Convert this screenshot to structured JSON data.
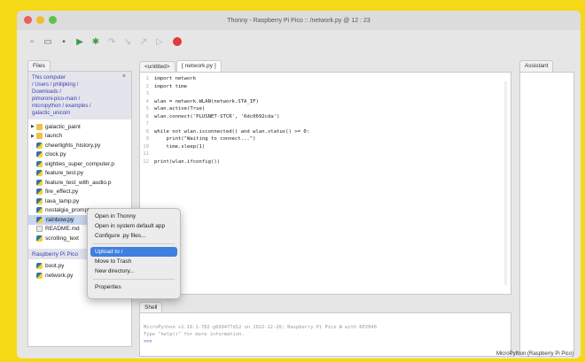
{
  "window": {
    "title": "Thonny - Raspberry Pi Pico :: /network.py @ 12 : 23"
  },
  "panes": {
    "files_tab": "Files",
    "editor_tabs": [
      "<untitled>",
      "[ network.py ]"
    ],
    "shell_tab": "Shell",
    "assistant_tab": "Assistant"
  },
  "files": {
    "path_lines": [
      "This computer",
      "/ Users / philipking /",
      "Downloads /",
      "pimoroni-pico-main /",
      "micropython / examples /",
      "galactic_unicorn"
    ],
    "items": [
      {
        "name": "galactic_paint",
        "kind": "folder",
        "expandable": "▶"
      },
      {
        "name": "launch",
        "kind": "folder",
        "expandable": "▶"
      },
      {
        "name": "cheerlights_history.py",
        "kind": "py"
      },
      {
        "name": "clock.py",
        "kind": "py"
      },
      {
        "name": "eighties_super_computer.p",
        "kind": "py"
      },
      {
        "name": "feature_test.py",
        "kind": "py"
      },
      {
        "name": "feature_test_with_audio.p",
        "kind": "py"
      },
      {
        "name": "fire_effect.py",
        "kind": "py"
      },
      {
        "name": "lava_lamp.py",
        "kind": "py"
      },
      {
        "name": "nostalgia_prompt.py",
        "kind": "py"
      },
      {
        "name": "rainbow.py",
        "kind": "py",
        "selected": true
      },
      {
        "name": "README.md",
        "kind": "doc"
      },
      {
        "name": "scrolling_text",
        "kind": "py"
      }
    ],
    "pico_header": "Raspberry Pi Pico",
    "pico_items": [
      {
        "name": "boot.py",
        "kind": "py"
      },
      {
        "name": "network.py",
        "kind": "py"
      }
    ]
  },
  "editor": {
    "lines": [
      "import network",
      "import time",
      "",
      "wlan = network.WLAN(network.STA_IF)",
      "wlan.active(True)",
      "wlan.connect('PLUSNET-STCR', '6dc0692cda')",
      "",
      "while not wlan.isconnected() and wlan.status() >= 0:",
      "    print(\"Waiting to connect...\")",
      "    time.sleep(1)",
      "",
      "print(wlan.ifconfig())"
    ]
  },
  "shell": {
    "banner": "MicroPython v1.19.1-782-g699477d12 on 2022-12-20; Raspberry Pi Pico W with RP2040",
    "hint": "Type \"help()\" for more information.",
    "prompt": ">>>"
  },
  "context_menu": {
    "items": [
      "Open in Thonny",
      "Open in system default app",
      "Configure .py files...",
      "Upload to /",
      "Move to Trash",
      "New directory...",
      "Properties"
    ],
    "highlighted": "Upload to /"
  },
  "status": {
    "interpreter": "MicroPython (Raspberry Pi Pico)"
  },
  "colors": {
    "background": "#f5d916",
    "selection": "#3f7fe0",
    "path_text": "#3b3fb1"
  }
}
